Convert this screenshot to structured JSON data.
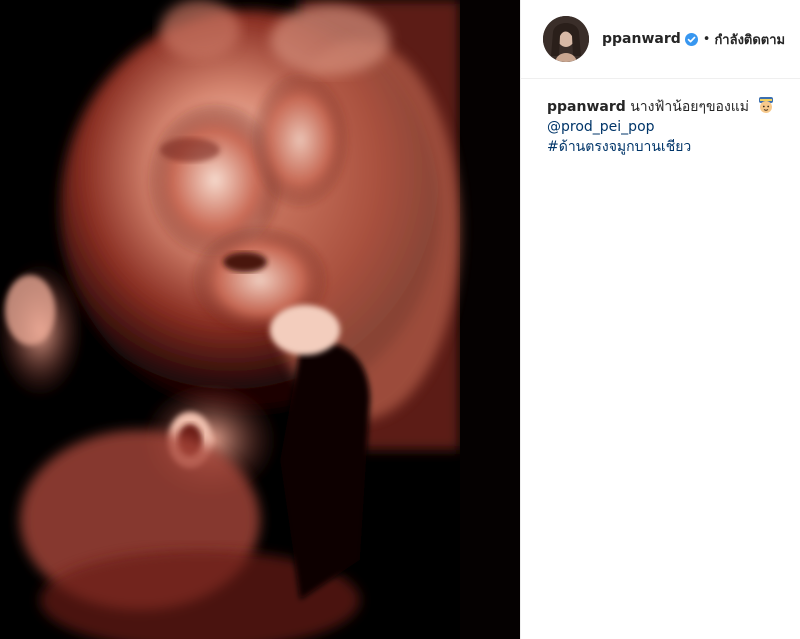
{
  "post": {
    "media_alt_icon": "ultrasound-photo",
    "header": {
      "username": "ppanward",
      "verified_icon": "verified-badge-icon",
      "separator": "•",
      "follow_status": "กำลังติดตาม"
    },
    "caption": {
      "username": "ppanward",
      "text": "นางฟ้าน้อยๆของแม่",
      "emoji_icon": "baby-face-emoji-icon",
      "mention": "@prod_pei_pop",
      "hashtag": "#ด้านตรงจมูกบานเชียว"
    }
  },
  "colors": {
    "link": "#003569",
    "verified": "#3897f0",
    "text": "#262626"
  }
}
